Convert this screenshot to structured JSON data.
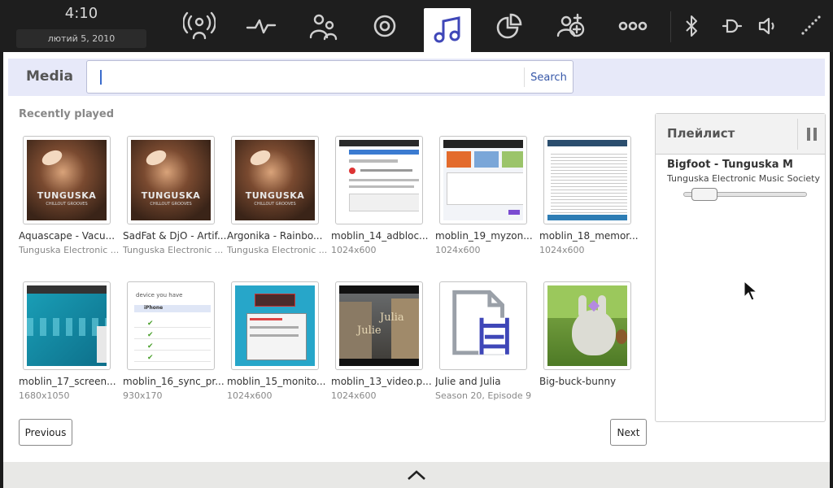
{
  "status": {
    "time": "4:10",
    "date": "лютий  5, 2010"
  },
  "zones": [
    {
      "name": "status-zone",
      "icon": "broadcast-icon"
    },
    {
      "name": "activity-zone",
      "icon": "pulse-icon"
    },
    {
      "name": "people-zone",
      "icon": "people-icon"
    },
    {
      "name": "internet-zone",
      "icon": "target-icon"
    },
    {
      "name": "media-zone",
      "icon": "music-note-icon",
      "active": true
    },
    {
      "name": "apps-zone",
      "icon": "pie-icon"
    },
    {
      "name": "pasteboard-zone",
      "icon": "add-contact-icon"
    },
    {
      "name": "zones-zone",
      "icon": "zones-icon"
    }
  ],
  "tray": [
    "bluetooth-icon",
    "power-plug-icon",
    "volume-icon",
    "network-icon"
  ],
  "media": {
    "title": "Media",
    "search_placeholder": "",
    "search_label": "Search"
  },
  "recent": {
    "title": "Recently played",
    "items": [
      {
        "name": "Aquascape - Vacu...",
        "sub": "Tunguska Electronic ...",
        "thumb": "tunguska"
      },
      {
        "name": "SadFat & DjO - Artif...",
        "sub": "Tunguska Electronic ...",
        "thumb": "tunguska"
      },
      {
        "name": "Argonika - Rainbo...",
        "sub": "Tunguska Electronic ...",
        "thumb": "tunguska"
      },
      {
        "name": "moblin_14_adbloc...",
        "sub": "1024x600",
        "thumb": "screen"
      },
      {
        "name": "moblin_19_myzon...",
        "sub": "1024x600",
        "thumb": "screen"
      },
      {
        "name": "moblin_18_memor...",
        "sub": "1024x600",
        "thumb": "screen"
      },
      {
        "name": "moblin_17_screen...",
        "sub": "1680x1050",
        "thumb": "teal"
      },
      {
        "name": "moblin_16_sync_pr...",
        "sub": "930x170",
        "thumb": "list"
      },
      {
        "name": "moblin_15_monito...",
        "sub": "1024x600",
        "thumb": "dialog"
      },
      {
        "name": "moblin_13_video.p...",
        "sub": "1024x600",
        "thumb": "video"
      },
      {
        "name": "Julie and Julia",
        "sub": "Season 20, Episode 9",
        "thumb": "doc"
      },
      {
        "name": "Big-buck-bunny",
        "sub": "",
        "thumb": "bunny"
      }
    ],
    "thumb_text": {
      "tunguska": "TUNGUSKA",
      "tunguska_sub": "CHILLOUT GROOVES",
      "sync": "device you have",
      "sync_row": "iPhone",
      "video": "Julia",
      "video2": "Julie"
    }
  },
  "pager": {
    "previous": "Previous",
    "next": "Next"
  },
  "playlist": {
    "title": "Плейлист",
    "track": "Bigfoot - Tunguska M",
    "artist": "Tunguska Electronic Music Society",
    "progress": 0.08
  },
  "colors": {
    "accent": "#3f47b8",
    "panel": "#ffffff",
    "topbar": "#1e1e1e"
  }
}
